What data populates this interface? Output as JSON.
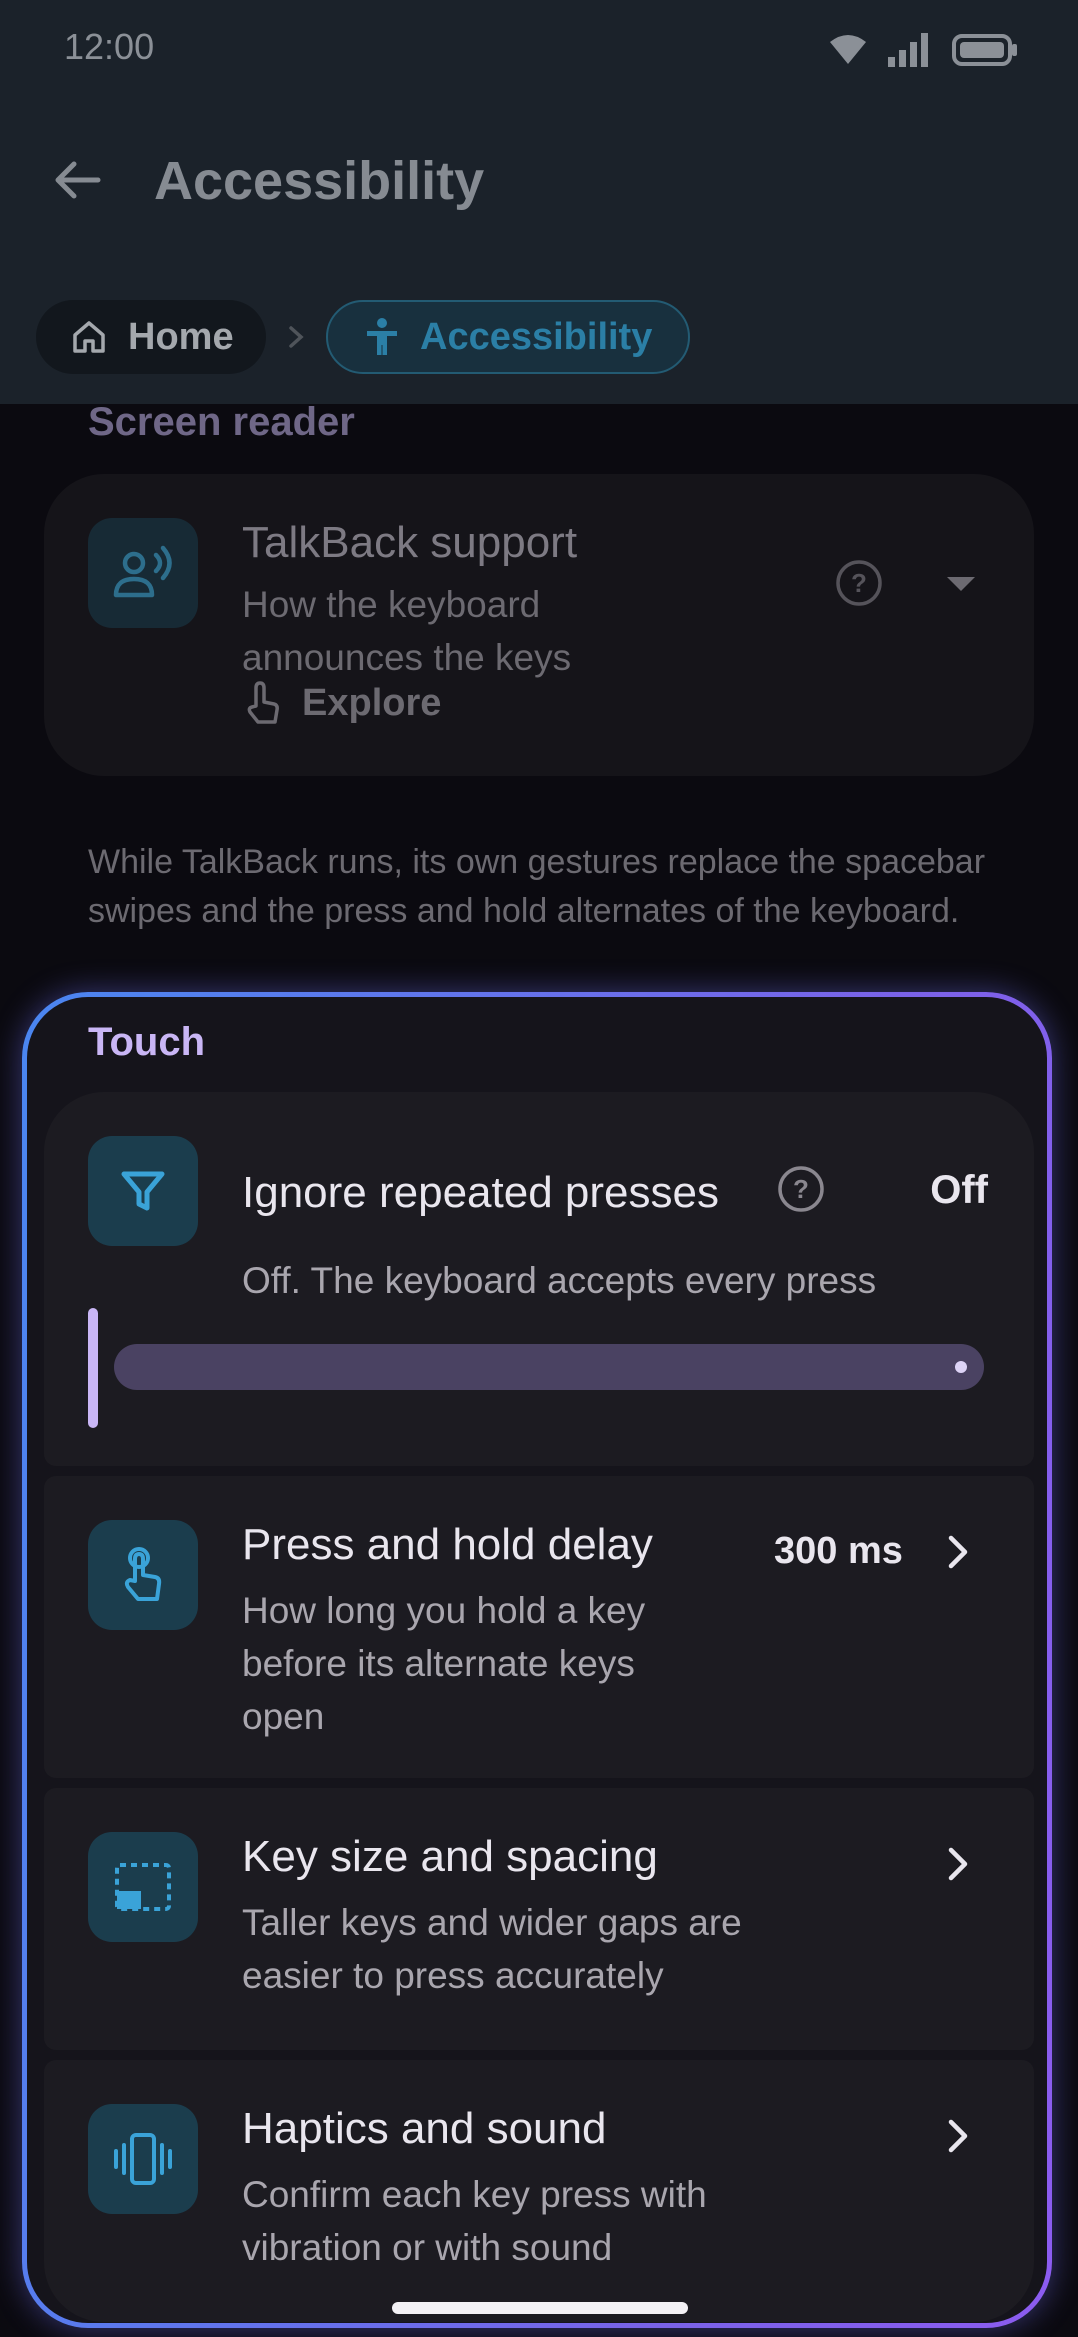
{
  "status_bar": {
    "time": "12:00"
  },
  "top_bar": {
    "title": "Accessibility"
  },
  "breadcrumb": {
    "home": "Home",
    "current": "Accessibility"
  },
  "screen_reader": {
    "section_title": "Screen reader",
    "talkback": {
      "title": "TalkBack support",
      "subtitle": "How the keyboard announces the keys",
      "mode": "Explore"
    },
    "note": "While TalkBack runs, its own gestures replace the spacebar swipes and the press and hold alternates of the keyboard."
  },
  "touch": {
    "section_title": "Touch",
    "ignore_repeated": {
      "title": "Ignore repeated presses",
      "value": "Off",
      "subtitle": "Off. The keyboard accepts every press",
      "slider_fraction": 1.0
    },
    "press_hold": {
      "title": "Press and hold delay",
      "value": "300 ms",
      "subtitle": "How long you hold a key before its alternate keys open"
    },
    "key_size": {
      "title": "Key size and spacing",
      "subtitle": "Taller keys and wider gaps are easier to press accurately"
    },
    "haptics": {
      "title": "Haptics and sound",
      "subtitle": "Confirm each key press with vibration or with sound"
    }
  },
  "colors": {
    "accent": "#3aa3d8",
    "purple": "#c9b6f5",
    "header_bg": "#1b222a",
    "frame_start": "#4a86f0",
    "frame_end": "#8c5cf0"
  }
}
